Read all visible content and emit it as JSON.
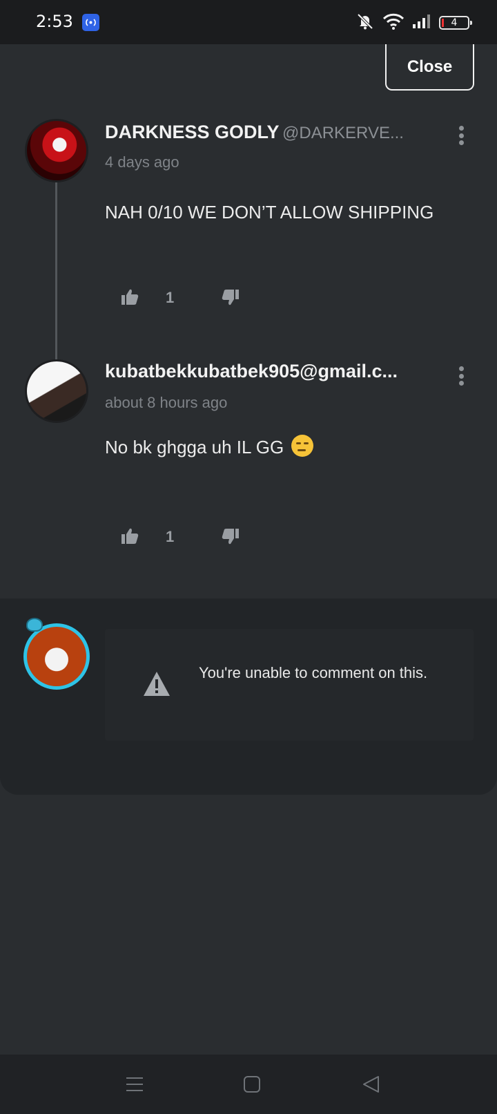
{
  "status_bar": {
    "time": "2:53",
    "battery_level": "4",
    "icons": [
      "hotspot-icon",
      "mute-bell-icon",
      "wifi-icon",
      "signal-icon",
      "battery-icon"
    ]
  },
  "sheet": {
    "close_label": "Close"
  },
  "comments": [
    {
      "author": "DARKNESS GODLY",
      "handle": "@DARKERVE...",
      "time": "4 days ago",
      "body": "NAH 0/10 WE DON’T ALLOW SHIPPING",
      "likes": "1"
    },
    {
      "author": "kubatbekkubatbek905@gmail.c...",
      "handle": "",
      "time": "about 8 hours ago",
      "body": "No bk ghgga uh IL GG",
      "emoji": "unamused-face-emoji",
      "likes": "1"
    }
  ],
  "composer": {
    "notice": "You're unable to comment on this."
  },
  "colors": {
    "background": "#2a2d30",
    "composer_background": "#222528",
    "avatar_ring": "#2ec3e6",
    "battery_low": "#e33333"
  }
}
